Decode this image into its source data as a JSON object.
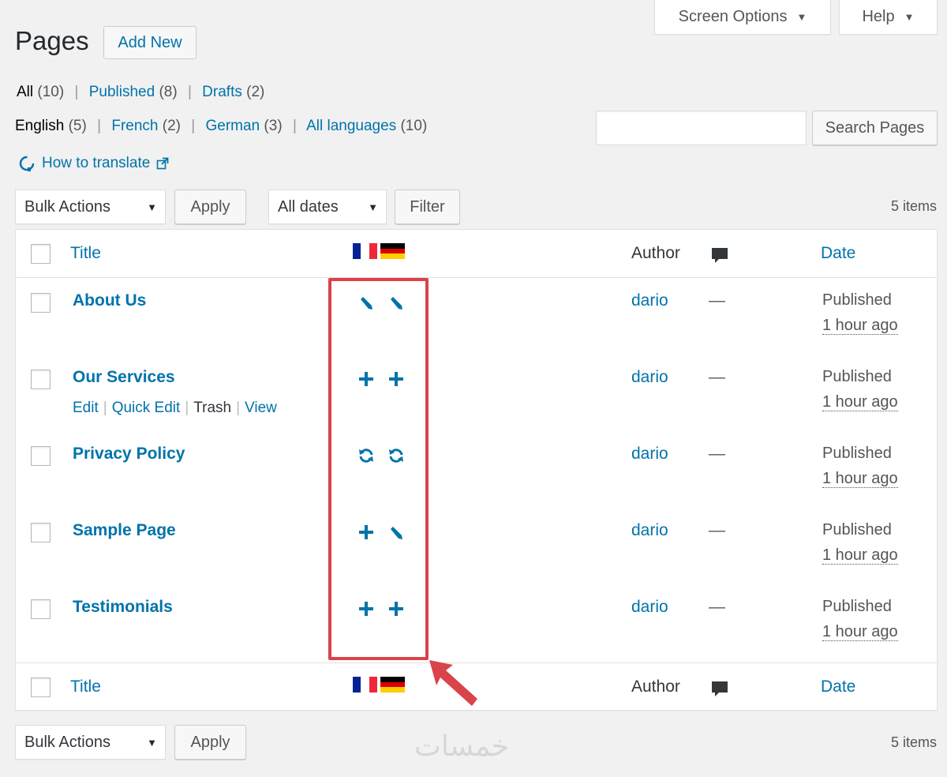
{
  "top_tabs": {
    "screen_options": "Screen Options",
    "help": "Help"
  },
  "header": {
    "title": "Pages",
    "add_new": "Add New"
  },
  "status_filters": [
    {
      "label": "All",
      "count": "(10)"
    },
    {
      "label": "Published",
      "count": "(8)"
    },
    {
      "label": "Drafts",
      "count": "(2)"
    }
  ],
  "language_filters": [
    {
      "label": "English",
      "count": "(5)"
    },
    {
      "label": "French",
      "count": "(2)"
    },
    {
      "label": "German",
      "count": "(3)"
    },
    {
      "label": "All languages",
      "count": "(10)"
    }
  ],
  "how_to_translate": "How to translate",
  "search": {
    "button": "Search Pages",
    "value": ""
  },
  "top_nav": {
    "bulk_actions": "Bulk Actions",
    "apply": "Apply",
    "dates": "All dates",
    "filter": "Filter",
    "count": "5 items"
  },
  "bottom_nav": {
    "bulk_actions": "Bulk Actions",
    "apply": "Apply",
    "count": "5 items"
  },
  "columns": {
    "title": "Title",
    "author": "Author",
    "date": "Date"
  },
  "flag_colors": {
    "fr": [
      "#002395",
      "#ffffff",
      "#ed2939"
    ],
    "de": [
      "#000000",
      "#dd0000",
      "#ffce00"
    ]
  },
  "rows": [
    {
      "title": "About Us",
      "icons": [
        "pencil-icon",
        "pencil-icon"
      ],
      "author": "dario",
      "comments": "—",
      "status": "Published",
      "time": "1 hour ago"
    },
    {
      "title": "Our Services",
      "icons": [
        "plus-icon",
        "plus-icon"
      ],
      "author": "dario",
      "comments": "—",
      "status": "Published",
      "time": "1 hour ago",
      "actions": {
        "edit": "Edit",
        "quick_edit": "Quick Edit",
        "trash": "Trash",
        "view": "View"
      }
    },
    {
      "title": "Privacy Policy",
      "icons": [
        "refresh-icon",
        "refresh-icon"
      ],
      "author": "dario",
      "comments": "—",
      "status": "Published",
      "time": "1 hour ago"
    },
    {
      "title": "Sample Page",
      "icons": [
        "plus-icon",
        "pencil-icon"
      ],
      "author": "dario",
      "comments": "—",
      "status": "Published",
      "time": "1 hour ago"
    },
    {
      "title": "Testimonials",
      "icons": [
        "plus-icon",
        "plus-icon"
      ],
      "author": "dario",
      "comments": "—",
      "status": "Published",
      "time": "1 hour ago"
    }
  ],
  "annotation": {
    "highlight_color": "#d9434a"
  },
  "watermark": "خمسات"
}
